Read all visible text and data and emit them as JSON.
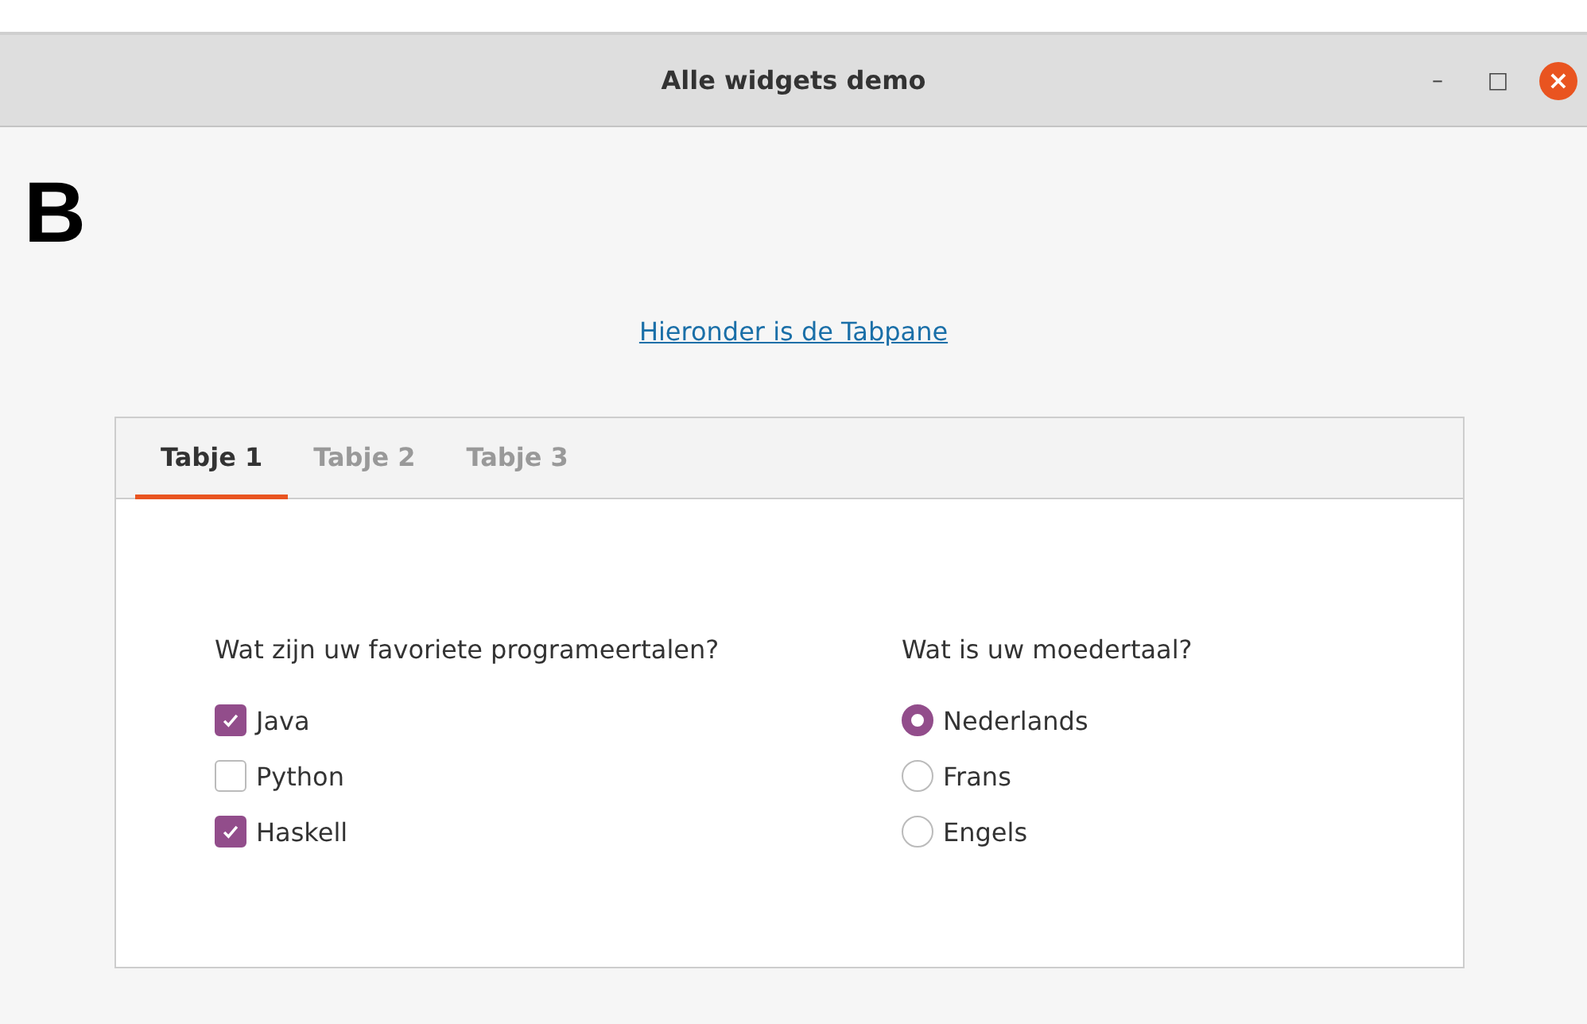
{
  "window": {
    "title": "Alle widgets demo",
    "controls": [
      "–",
      "□",
      "×"
    ]
  },
  "figure_label": "B",
  "link": "Hieronder is de Tabpane",
  "tabs": [
    {
      "label": "Tabje 1",
      "selected": true
    },
    {
      "label": "Tabje 2",
      "selected": false
    },
    {
      "label": "Tabje 3",
      "selected": false
    }
  ],
  "languages": {
    "question": "Wat zijn uw favoriete programeertalen?",
    "options": [
      {
        "label": "Java",
        "checked": true
      },
      {
        "label": "Python",
        "checked": false
      },
      {
        "label": "Haskell",
        "checked": true
      }
    ]
  },
  "mother_tongue": {
    "question": "Wat is uw moedertaal?",
    "options": [
      {
        "label": "Nederlands",
        "selected": true
      },
      {
        "label": "Frans",
        "selected": false
      },
      {
        "label": "Engels",
        "selected": false
      }
    ]
  }
}
